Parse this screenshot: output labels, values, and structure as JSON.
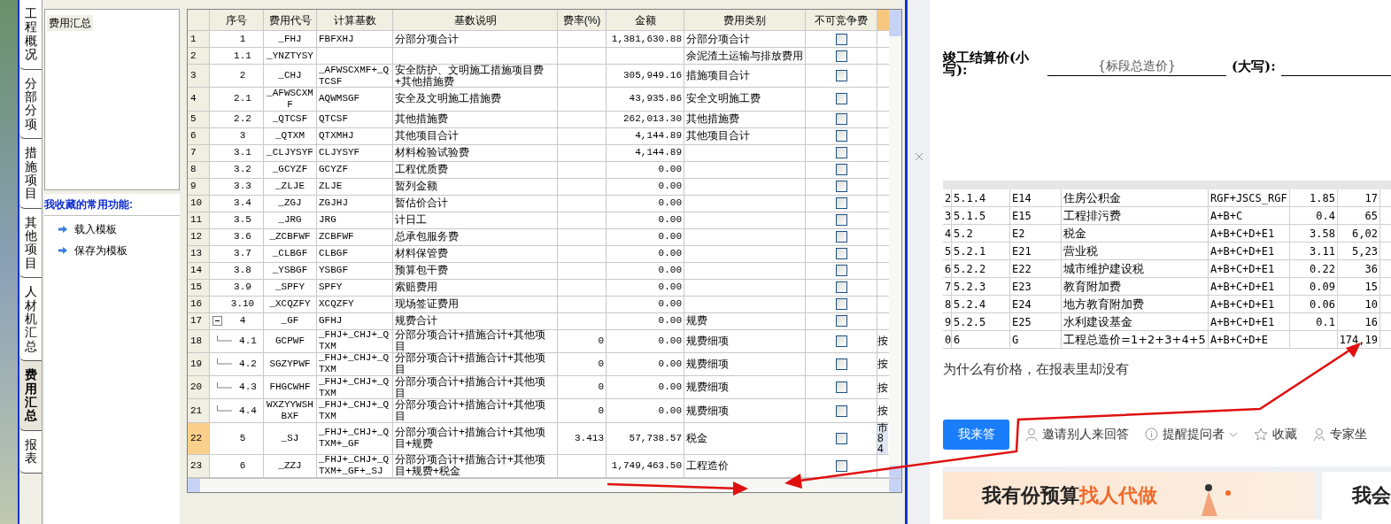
{
  "side_tabs": [
    {
      "label": "工程概况",
      "selected": false
    },
    {
      "label": "分部分项",
      "selected": false
    },
    {
      "label": "措施项目",
      "selected": false
    },
    {
      "label": "其他项目",
      "selected": false
    },
    {
      "label": "人材机汇总",
      "selected": false
    },
    {
      "label": "费用汇总",
      "selected": true
    },
    {
      "label": "报表",
      "selected": false
    }
  ],
  "left_panel": {
    "tree_items": [
      "费用汇总"
    ],
    "favorites_title": "我收藏的常用功能:",
    "favorites": [
      "载入模板",
      "保存为模板"
    ]
  },
  "table": {
    "columns": [
      "序号",
      "费用代号",
      "计算基数",
      "基数说明",
      "费率(%)",
      "金额",
      "费用类别",
      "不可竞争费"
    ],
    "rows": [
      {
        "no": "1",
        "seq": "1",
        "code": "_FHJ",
        "base": "FBFXHJ",
        "desc": "分部分项合计",
        "amount": "1,381,630.88",
        "category": "分部分项合计",
        "checked": false,
        "selected": false
      },
      {
        "no": "2",
        "seq": "1.1",
        "code": "_YNZTYSY",
        "category": "余泥渣土运输与排放费用",
        "checked": false,
        "selected": false
      },
      {
        "no": "3",
        "seq": "2",
        "code": "_CHJ",
        "base": "_AFWSCXMF+_QTCSF",
        "desc": "安全防护、文明施工措施项目费+其他措施费",
        "amount": "305,949.16",
        "category": "措施项目合计",
        "checked": false,
        "selected": false
      },
      {
        "no": "4",
        "seq": "2.1",
        "code": "_AFWSCXMF",
        "base": "AQWMSGF",
        "desc": "安全及文明施工措施费",
        "amount": "43,935.86",
        "category": "安全文明施工费",
        "checked": false,
        "selected": false
      },
      {
        "no": "5",
        "seq": "2.2",
        "code": "_QTCSF",
        "base": "QTCSF",
        "desc": "其他措施费",
        "amount": "262,013.30",
        "category": "其他措施费",
        "checked": false,
        "selected": false
      },
      {
        "no": "6",
        "seq": "3",
        "code": "_QTXM",
        "base": "QTXMHJ",
        "desc": "其他项目合计",
        "amount": "4,144.89",
        "category": "其他项目合计",
        "checked": false,
        "selected": false
      },
      {
        "no": "7",
        "seq": "3.1",
        "code": "_CLJYSYF",
        "base": "CLJYSYF",
        "desc": "材料检验试验费",
        "amount": "4,144.89",
        "checked": false,
        "selected": false
      },
      {
        "no": "8",
        "seq": "3.2",
        "code": "_GCYZF",
        "base": "GCYZF",
        "desc": "工程优质费",
        "amount": "0.00",
        "checked": false,
        "selected": false
      },
      {
        "no": "9",
        "seq": "3.3",
        "code": "_ZLJE",
        "base": "ZLJE",
        "desc": "暂列金额",
        "amount": "0.00",
        "checked": false,
        "selected": false
      },
      {
        "no": "10",
        "seq": "3.4",
        "code": "_ZGJ",
        "base": "ZGJHJ",
        "desc": "暂估价合计",
        "amount": "0.00",
        "checked": false,
        "selected": false
      },
      {
        "no": "11",
        "seq": "3.5",
        "code": "_JRG",
        "base": "JRG",
        "desc": "计日工",
        "amount": "0.00",
        "checked": false,
        "selected": false
      },
      {
        "no": "12",
        "seq": "3.6",
        "code": "_ZCBFWF",
        "base": "ZCBFWF",
        "desc": "总承包服务费",
        "amount": "0.00",
        "checked": false,
        "selected": false
      },
      {
        "no": "13",
        "seq": "3.7",
        "code": "_CLBGF",
        "base": "CLBGF",
        "desc": "材料保管费",
        "amount": "0.00",
        "checked": false,
        "selected": false
      },
      {
        "no": "14",
        "seq": "3.8",
        "code": "_YSBGF",
        "base": "YSBGF",
        "desc": "预算包干费",
        "amount": "0.00",
        "checked": false,
        "selected": false
      },
      {
        "no": "15",
        "seq": "3.9",
        "code": "_SPFY",
        "base": "SPFY",
        "desc": "索赔费用",
        "amount": "0.00",
        "checked": false,
        "selected": false
      },
      {
        "no": "16",
        "seq": "3.10",
        "code": "_XCQZFY",
        "base": "XCQZFY",
        "desc": "现场签证费用",
        "amount": "0.00",
        "checked": false,
        "selected": false
      },
      {
        "no": "17",
        "seq": "4",
        "code": "_GF",
        "base": "GFHJ",
        "desc": "规费合计",
        "amount": "0.00",
        "category": "规费",
        "checked": false,
        "selected": false,
        "expanded": true,
        "children": [
          {
            "no": "18",
            "seq": "4.1",
            "code": "GCPWF",
            "base": "_FHJ+_CHJ+_QTXM",
            "desc": "分部分项合计+措施合计+其他项目",
            "rate": "0",
            "amount": "0.00",
            "category": "规费细项",
            "checked": false,
            "column_10": "按",
            "selected": false
          },
          {
            "no": "19",
            "seq": "4.2",
            "code": "SGZYPWF",
            "base": "_FHJ+_CHJ+_QTXM",
            "desc": "分部分项合计+措施合计+其他项目",
            "rate": "0",
            "amount": "0.00",
            "category": "规费细项",
            "checked": false,
            "column_10": "按",
            "selected": false
          },
          {
            "no": "20",
            "seq": "4.3",
            "code": "FHGCWHF",
            "base": "_FHJ+_CHJ+_QTXM",
            "desc": "分部分项合计+措施合计+其他项目",
            "rate": "0",
            "amount": "0.00",
            "category": "规费细项",
            "checked": false,
            "column_10": "按",
            "selected": false
          },
          {
            "no": "21",
            "seq": "4.4",
            "code": "WXZYYWSHBXF",
            "base": "_FHJ+_CHJ+_QTXM",
            "desc": "分部分项合计+措施合计+其他项目",
            "rate": "0",
            "amount": "0.00",
            "category": "规费细项",
            "checked": false,
            "column_10": "按",
            "selected": false
          }
        ]
      },
      {
        "no": "22",
        "seq": "5",
        "code": "_SJ",
        "base": "_FHJ+_CHJ+_QTXM+_GF",
        "desc": "分部分项合计+措施合计+其他项目+规费",
        "rate": "3.413",
        "amount": "57,738.57",
        "category": "税金",
        "checked": false,
        "column_10": "市84",
        "selected": true
      },
      {
        "no": "23",
        "seq": "6",
        "code": "_ZZJ",
        "base": "_FHJ+_CHJ+_QTXM+_GF+_SJ",
        "desc": "分部分项合计+措施合计+其他项目+规费+税金",
        "amount": "1,749,463.50",
        "category": "工程造价",
        "checked": false,
        "selected": false
      }
    ]
  },
  "web_page": {
    "price_label": "竣工结算价(小写):",
    "price_value": "{标段总造价}",
    "upper_label": "(大写):",
    "question_table": [
      {
        "no": "2",
        "seq": "5.1.4",
        "code": "E14",
        "name": "住房公积金",
        "formula": "RGF+JSCS_RGF",
        "rate": "1.85",
        "amount": "17"
      },
      {
        "no": "3",
        "seq": "5.1.5",
        "code": "E15",
        "name": "工程排污费",
        "formula": "A+B+C",
        "rate": "0.4",
        "amount": "65"
      },
      {
        "no": "4",
        "seq": "5.2",
        "code": "E2",
        "name": "税金",
        "formula": "A+B+C+D+E1",
        "rate": "3.58",
        "amount": "6,02"
      },
      {
        "no": "5",
        "seq": "5.2.1",
        "code": "E21",
        "name": "营业税",
        "formula": "A+B+C+D+E1",
        "rate": "3.11",
        "amount": "5,23"
      },
      {
        "no": "6",
        "seq": "5.2.2",
        "code": "E22",
        "name": "城市维护建设税",
        "formula": "A+B+C+D+E1",
        "rate": "0.22",
        "amount": "36"
      },
      {
        "no": "7",
        "seq": "5.2.3",
        "code": "E23",
        "name": "教育附加费",
        "formula": "A+B+C+D+E1",
        "rate": "0.09",
        "amount": "15"
      },
      {
        "no": "8",
        "seq": "5.2.4",
        "code": "E24",
        "name": "地方教育附加费",
        "formula": "A+B+C+D+E1",
        "rate": "0.06",
        "amount": "10"
      },
      {
        "no": "9",
        "seq": "5.2.5",
        "code": "E25",
        "name": "水利建设基金",
        "formula": "A+B+C+D+E1",
        "rate": "0.1",
        "amount": "16"
      },
      {
        "no": "0",
        "seq": "6",
        "code": "G",
        "name": "工程总造价=1+2+3+4+5",
        "formula": "A+B+C+D+E",
        "amount": "174,19"
      }
    ],
    "question": "为什么有价格，在报表里却没有",
    "answer_button": "我来答",
    "actions": [
      {
        "kind": "invite",
        "label": "邀请别人来回答"
      },
      {
        "kind": "remind",
        "label": "提醒提问者"
      },
      {
        "kind": "favorite",
        "label": "收藏"
      },
      {
        "kind": "expert",
        "label": "专家坐"
      }
    ],
    "banner": {
      "title": "我有份预算",
      "highlight": "找人代做",
      "second_title": "我会"
    }
  }
}
